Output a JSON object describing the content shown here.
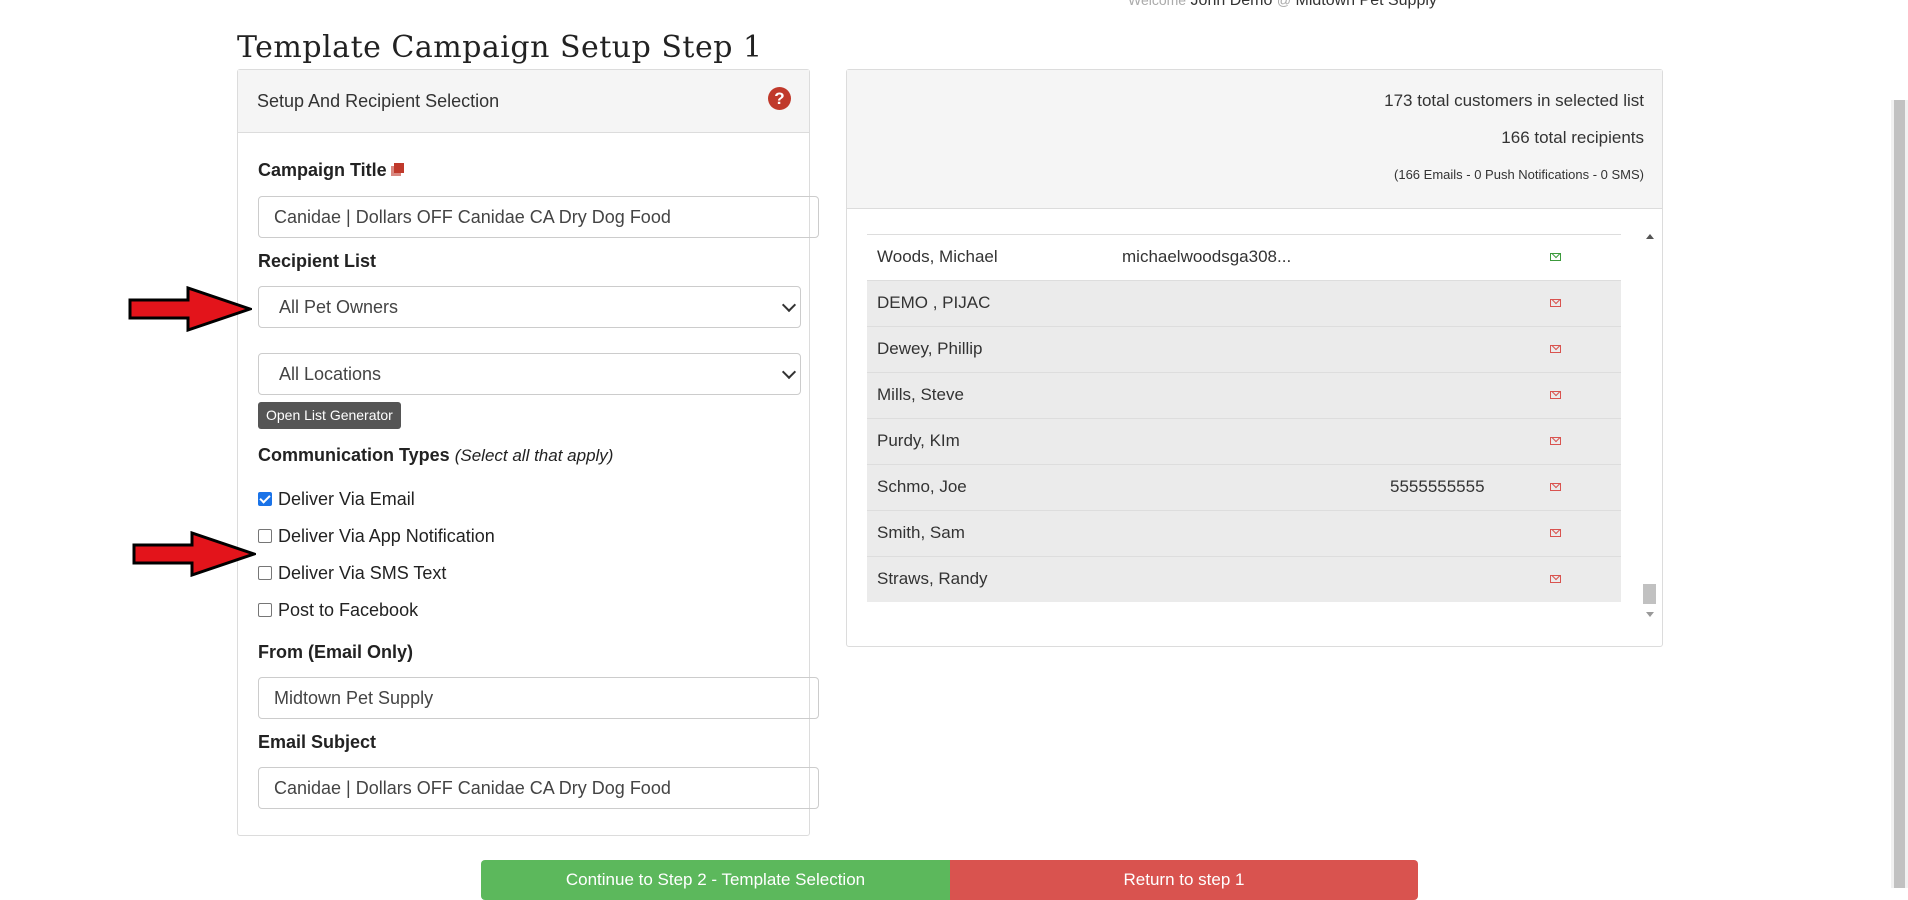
{
  "header": {
    "welcome_prefix": "Welcome",
    "user_name": "John Demo",
    "at_symbol": "@",
    "store_name": "Midtown Pet Supply",
    "page_title": "Template Campaign Setup Step 1"
  },
  "setup_panel": {
    "title": "Setup And Recipient Selection",
    "help_icon": "?",
    "campaign_title_label": "Campaign Title",
    "campaign_title_value": "Canidae | Dollars OFF Canidae CA Dry Dog Food",
    "recipient_list_label": "Recipient List",
    "recipient_list_selected": "All Pet Owners",
    "location_selected": "All Locations",
    "open_list_generator_label": "Open List Generator",
    "comm_types_label": "Communication Types",
    "comm_types_hint": "(Select all that apply)",
    "comm_options": [
      {
        "label": "Deliver Via Email",
        "checked": true
      },
      {
        "label": "Deliver Via App Notification",
        "checked": false
      },
      {
        "label": "Deliver Via SMS Text",
        "checked": false
      },
      {
        "label": "Post to Facebook",
        "checked": false
      }
    ],
    "from_label": "From (Email Only)",
    "from_value": "Midtown Pet Supply",
    "subject_label": "Email Subject",
    "subject_value": "Canidae | Dollars OFF Canidae CA Dry Dog Food"
  },
  "recipients_panel": {
    "total_customers": "173 total customers in selected list",
    "total_recipients": "166 total recipients",
    "breakdown": "(166 Emails - 0 Push Notifications - 0 SMS)",
    "rows": [
      {
        "name": "Woods, Michael",
        "email": "michaelwoodsga308...",
        "phone": "",
        "status": "ok"
      },
      {
        "name": "DEMO , PIJAC",
        "email": "",
        "phone": "",
        "status": "warn"
      },
      {
        "name": "Dewey, Phillip",
        "email": "",
        "phone": "",
        "status": "warn"
      },
      {
        "name": "Mills, Steve",
        "email": "",
        "phone": "",
        "status": "warn"
      },
      {
        "name": "Purdy, KIm",
        "email": "",
        "phone": "",
        "status": "warn"
      },
      {
        "name": "Schmo, Joe",
        "email": "",
        "phone": "5555555555",
        "status": "warn"
      },
      {
        "name": "Smith, Sam",
        "email": "",
        "phone": "",
        "status": "warn"
      },
      {
        "name": "Straws, Randy",
        "email": "",
        "phone": "",
        "status": "warn"
      }
    ]
  },
  "actions": {
    "continue_label": "Continue to Step 2 - Template Selection",
    "return_label": "Return to step 1"
  },
  "colors": {
    "accent_red": "#c0392b",
    "ok_green": "#5cb85c",
    "warn_red": "#d9534f",
    "arrow_red": "#e3141b"
  },
  "icons": [
    "help-icon",
    "copy-icon",
    "chevron-down-icon",
    "envelope-icon",
    "red-arrow-annotation"
  ]
}
